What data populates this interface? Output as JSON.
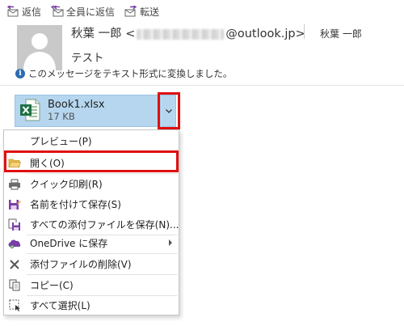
{
  "toolbar": {
    "reply_label": "返信",
    "reply_all_label": "全員に返信",
    "forward_label": "転送"
  },
  "message": {
    "sender_name": "秋葉 一郎 <",
    "sender_email_suffix": "@outlook.jp>",
    "to_name": "秋葉 一郎",
    "subject": "テスト",
    "info_text": "このメッセージをテキスト形式に変換しました。"
  },
  "attachment": {
    "file_name": "Book1.xlsx",
    "file_size": "17 KB",
    "icon": "excel-icon",
    "accent_color": "#b5d6ee"
  },
  "context_menu": {
    "items": [
      {
        "label": "プレビュー(P)",
        "icon": ""
      },
      {
        "label": "開く(O)",
        "icon": "folder-icon"
      },
      {
        "label": "クイック印刷(R)",
        "icon": "printer-icon"
      },
      {
        "label": "名前を付けて保存(S)",
        "icon": "save-as-icon"
      },
      {
        "label": "すべての添付ファイルを保存(N)...",
        "icon": "save-all-icon"
      },
      {
        "label": "OneDrive に保存",
        "icon": "onedrive-icon"
      },
      {
        "label": "添付ファイルの削除(V)",
        "icon": "delete-x-icon"
      },
      {
        "label": "コピー(C)",
        "icon": "copy-icon"
      },
      {
        "label": "すべて選択(L)",
        "icon": "select-all-icon"
      }
    ]
  },
  "highlight_color": "#e01010"
}
